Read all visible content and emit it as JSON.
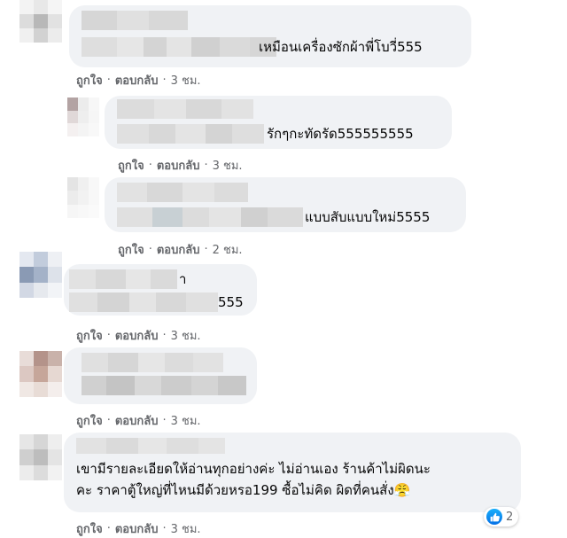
{
  "labels": {
    "like": "ถูกใจ",
    "reply": "ตอบกลับ",
    "sep": "·"
  },
  "comments": [
    {
      "text": "เหมือนเครื่องซักผ้าพี่โบวี่555",
      "time": "3 ชม."
    },
    {
      "text": "รักๆกะทัดรัด555555555",
      "time": "3 ชม."
    },
    {
      "text": "แบบสับแบบใหม่5555",
      "time": "2 ชม."
    },
    {
      "name_fragment": "า",
      "text": "555",
      "time": "3 ชม."
    },
    {
      "text": "",
      "time": "3 ชม."
    },
    {
      "text_lines": [
        "เขามีรายละเอียดให้อ่านทุกอย่างค่ะ ไม่อ่านเอง ร้านค้าไม่ผิดนะ",
        "คะ ราคาตู้ใหญ่ที่ไหนมีด้วยหรอ199 ซื้อไม่คิด ผิดที่คนสั่ง😤"
      ],
      "time": "3 ชม.",
      "reaction_count": "2",
      "reaction_icon": "like-icon"
    }
  ],
  "colors": {
    "bubble": "#f0f2f5",
    "meta": "#65676b",
    "like_blue": "#1877f2"
  }
}
